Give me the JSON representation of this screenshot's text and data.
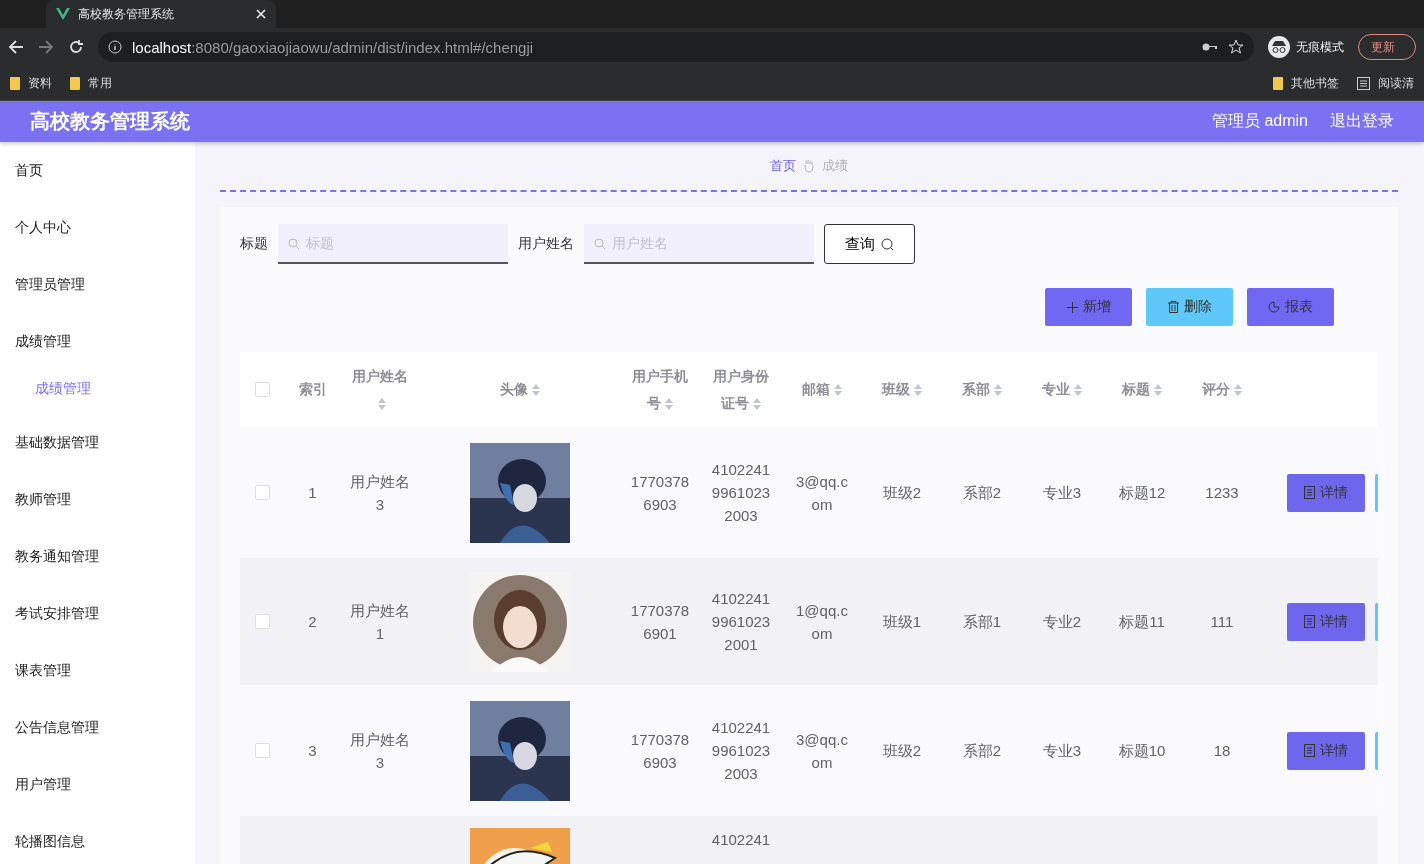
{
  "browser": {
    "tabs": [
      {
        "title": "高校教务管理系统",
        "selected": true
      }
    ],
    "url_host": "localhost",
    "url_path": ":8080/gaoxiaojiaowu/admin/dist/index.html#/chengji",
    "profile": "无痕模式",
    "update": "更新",
    "bookmarks": [
      "资料",
      "常用"
    ],
    "bookmarks_right": [
      "其他书签",
      "阅读清"
    ]
  },
  "header": {
    "title": "高校教务管理系统",
    "user": "管理员 admin",
    "logout": "退出登录"
  },
  "sidebar": {
    "items": [
      {
        "label": "首页",
        "selected": false
      },
      {
        "label": "个人中心",
        "selected": false
      },
      {
        "label": "管理员管理",
        "selected": false
      },
      {
        "label": "成绩管理",
        "selected": false,
        "expanded": true,
        "children": [
          {
            "label": "成绩管理",
            "selected": true
          }
        ]
      },
      {
        "label": "基础数据管理",
        "selected": false
      },
      {
        "label": "教师管理",
        "selected": false
      },
      {
        "label": "教务通知管理",
        "selected": false
      },
      {
        "label": "考试安排管理",
        "selected": false
      },
      {
        "label": "课表管理",
        "selected": false
      },
      {
        "label": "公告信息管理",
        "selected": false
      },
      {
        "label": "用户管理",
        "selected": false
      },
      {
        "label": "轮播图信息",
        "selected": false
      }
    ]
  },
  "breadcrumb": [
    "首页",
    "成绩"
  ],
  "search": {
    "fields": [
      {
        "label": "标题",
        "placeholder": "标题"
      },
      {
        "label": "用户姓名",
        "placeholder": "用户姓名"
      }
    ],
    "button": "查询"
  },
  "actions": [
    {
      "label": "新增",
      "kind": "add"
    },
    {
      "label": "删除",
      "kind": "delete"
    },
    {
      "label": "报表",
      "kind": "report"
    }
  ],
  "table": {
    "all_checked": false,
    "columns": [
      {
        "label": "索引",
        "sortable": false
      },
      {
        "label": "用户姓名",
        "sortable": true
      },
      {
        "label": "头像",
        "sortable": true
      },
      {
        "label": "用户手机号",
        "sortable": true
      },
      {
        "label": "用户身份证号",
        "sortable": true
      },
      {
        "label": "邮箱",
        "sortable": true
      },
      {
        "label": "班级",
        "sortable": true
      },
      {
        "label": "系部",
        "sortable": true
      },
      {
        "label": "专业",
        "sortable": true
      },
      {
        "label": "标题",
        "sortable": true
      },
      {
        "label": "评分",
        "sortable": true
      }
    ],
    "rows": [
      {
        "checked": false,
        "cells": [
          "1",
          "用户姓名3",
          {
            "kind": "picture"
          },
          "17703786903",
          "410224199610232003",
          "3@qq.com",
          "班级2",
          "系部2",
          "专业3",
          "标题12",
          "1233"
        ],
        "detail": "详情"
      },
      {
        "checked": false,
        "cells": [
          "2",
          "用户姓名1",
          {
            "kind": "picture"
          },
          "17703786901",
          "410224199610232001",
          "1@qq.com",
          "班级1",
          "系部1",
          "专业2",
          "标题11",
          "111"
        ],
        "detail": "详情"
      },
      {
        "checked": false,
        "cells": [
          "3",
          "用户姓名3",
          {
            "kind": "picture"
          },
          "17703786903",
          "410224199610232003",
          "3@qq.com",
          "班级2",
          "系部2",
          "专业3",
          "标题10",
          "18"
        ],
        "detail": "详情"
      },
      {
        "cells": [
          null,
          null,
          {
            "kind": "picture"
          },
          null,
          "4102241",
          null,
          null,
          null,
          null,
          null,
          null
        ]
      }
    ]
  }
}
